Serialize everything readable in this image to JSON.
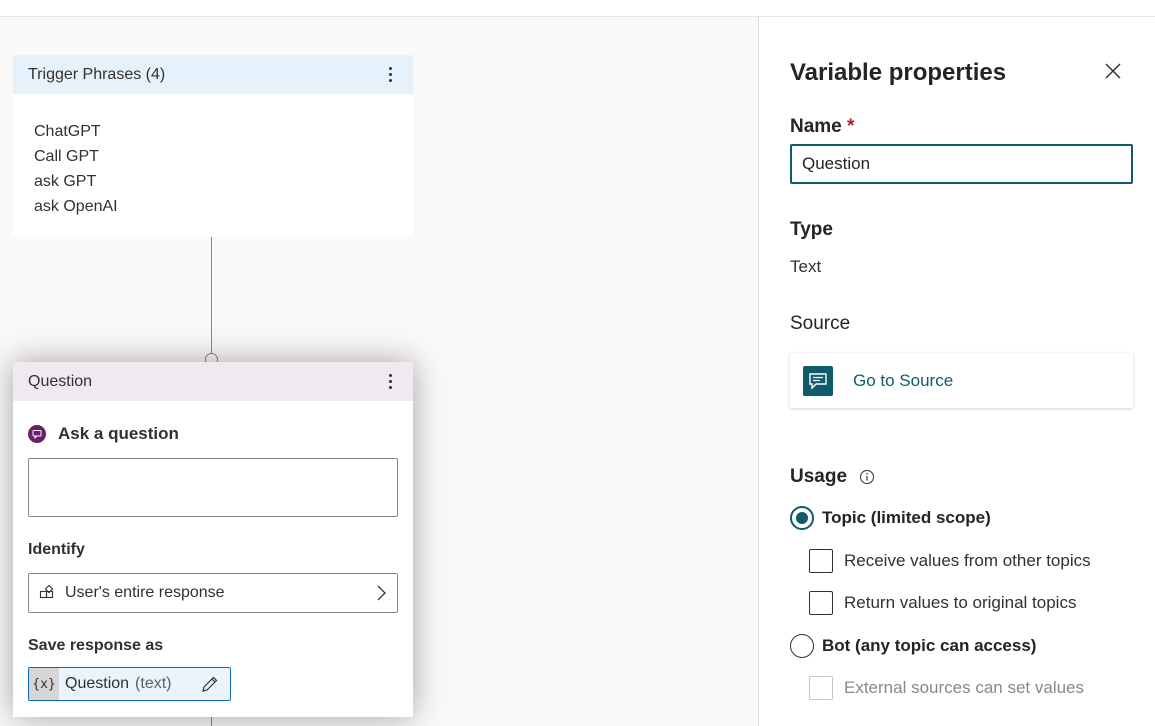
{
  "trigger_card": {
    "title": "Trigger Phrases (4)",
    "phrases": [
      "ChatGPT",
      "Call GPT",
      "ask GPT",
      "ask OpenAI"
    ]
  },
  "question_card": {
    "title": "Question",
    "ask_label": "Ask a question",
    "message_value": "",
    "identify_label": "Identify",
    "identify_value": "User's entire response",
    "save_label": "Save response as",
    "variable_badge": "{x}",
    "variable_name": "Question",
    "variable_type": "(text)"
  },
  "panel": {
    "title": "Variable properties",
    "name_label": "Name",
    "required_mark": "*",
    "name_value": "Question",
    "type_label": "Type",
    "type_value": "Text",
    "source_label": "Source",
    "source_link": "Go to Source",
    "usage_label": "Usage",
    "usage_options": [
      {
        "label": "Topic (limited scope)",
        "selected": true
      },
      {
        "label": "Bot (any topic can access)",
        "selected": false
      }
    ],
    "topic_checkboxes": [
      {
        "label": "Receive values from other topics",
        "checked": false
      },
      {
        "label": "Return values to original topics",
        "checked": false
      }
    ],
    "bot_checkbox": {
      "label": "External sources can set values",
      "checked": false,
      "disabled": true
    }
  },
  "colors": {
    "accent": "#0f5b6b",
    "trigger_header_bg": "#e6f2fb",
    "question_header_bg": "#f0e9f0",
    "question_icon": "#6b1f6b",
    "required": "#a4262c"
  },
  "icons": [
    "kebab-menu-icon",
    "chat-question-icon",
    "entity-icon",
    "chevron-right-icon",
    "pencil-icon",
    "close-icon",
    "message-source-icon",
    "info-icon"
  ]
}
